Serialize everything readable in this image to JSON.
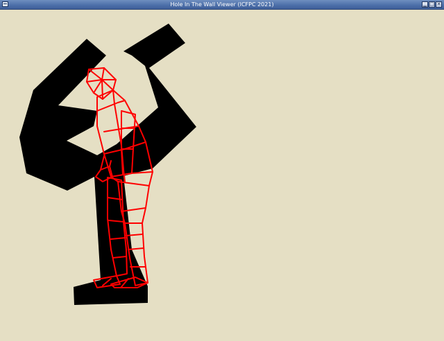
{
  "window": {
    "title": "Hole In The Wall Viewer (ICFPC 2021)",
    "controls": {
      "minimize": "▁",
      "maximize": "□",
      "close": "✕"
    }
  },
  "colors": {
    "background": "#e5dfc4",
    "hole": "#000000",
    "figure": "#ff0000"
  }
}
